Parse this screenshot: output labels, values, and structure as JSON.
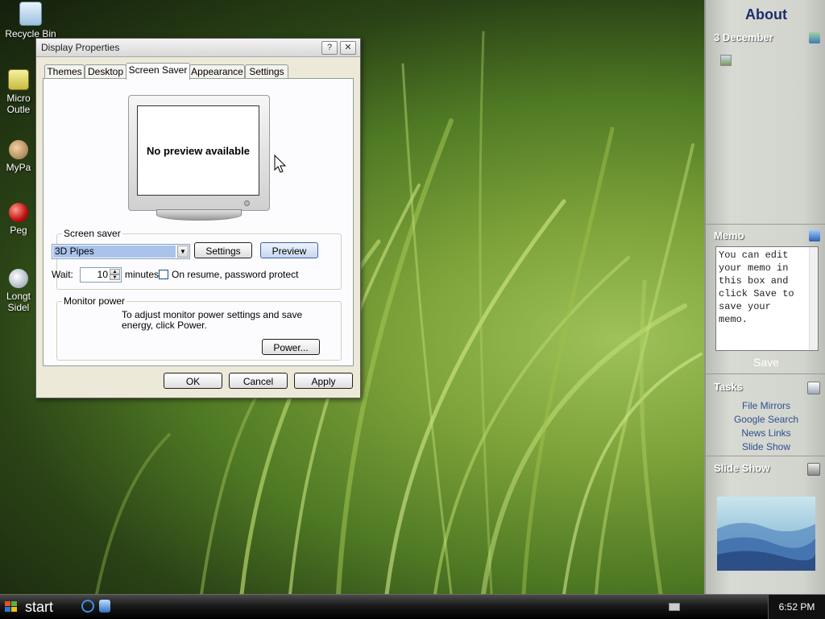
{
  "desktop": {
    "icons": [
      {
        "label": "Recycle Bin"
      },
      {
        "label": "Micro Outle"
      },
      {
        "label": "MyPa"
      },
      {
        "label": "Peg"
      },
      {
        "label": "Longt Sidel"
      }
    ]
  },
  "dialog": {
    "title": "Display Properties",
    "help_glyph": "?",
    "close_glyph": "✕",
    "tabs": [
      "Themes",
      "Desktop",
      "Screen Saver",
      "Appearance",
      "Settings"
    ],
    "active_tab": "Screen Saver",
    "preview_text": "No preview available",
    "screensaver": {
      "group_label": "Screen saver",
      "selected": "3D Pipes",
      "settings_label": "Settings",
      "preview_label": "Preview",
      "wait_label": "Wait:",
      "wait_value": "10",
      "minutes_label": "minutes",
      "resume_label": "On resume, password protect",
      "resume_checked": false
    },
    "monitor_power": {
      "group_label": "Monitor power",
      "text": "To adjust monitor power settings and save energy, click Power.",
      "power_label": "Power..."
    },
    "buttons": {
      "ok": "OK",
      "cancel": "Cancel",
      "apply": "Apply"
    }
  },
  "sidebar": {
    "header": "About",
    "calendar": {
      "title": "3 December"
    },
    "memo": {
      "title": "Memo",
      "text": "You can edit your memo in this box and click Save to save your memo.",
      "save_label": "Save"
    },
    "tasks": {
      "title": "Tasks",
      "items": [
        "File Mirrors",
        "Google Search",
        "News Links",
        "Slide Show"
      ]
    },
    "slideshow": {
      "title": "Slide Show"
    }
  },
  "taskbar": {
    "start_label": "start",
    "clock": "6:52 PM"
  },
  "colors": {
    "sidebar_header": "#1c2d6b",
    "link": "#2f4f8f",
    "selection": "#a9c3ea",
    "dialog_bg": "#ece9d8"
  }
}
